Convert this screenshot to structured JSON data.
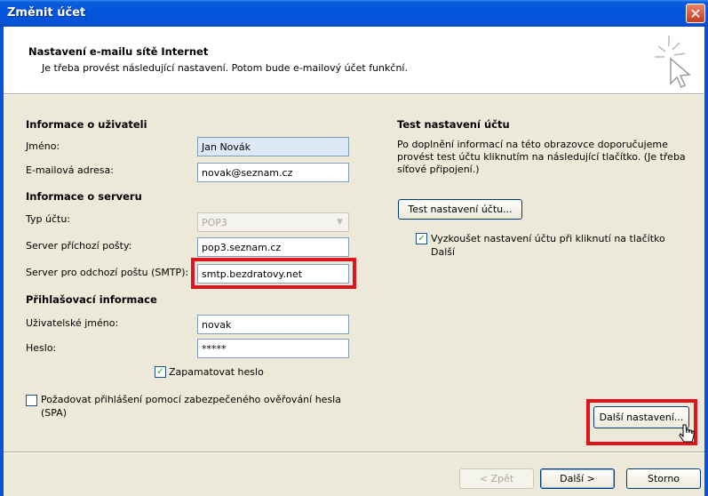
{
  "window": {
    "title": "Změnit účet"
  },
  "header": {
    "title": "Nastavení e-mailu sítě Internet",
    "subtitle": "Je třeba provést následující nastavení. Potom bude e-mailový účet funkční."
  },
  "user_info": {
    "section_title": "Informace o uživateli",
    "name_label": "Jméno:",
    "name_value": "Jan Novák",
    "email_label": "E-mailová adresa:",
    "email_value": "novak@seznam.cz"
  },
  "server_info": {
    "section_title": "Informace o serveru",
    "account_type_label": "Typ účtu:",
    "account_type_value": "POP3",
    "incoming_label": "Server příchozí pošty:",
    "incoming_value": "pop3.seznam.cz",
    "outgoing_label": "Server pro odchozí poštu (SMTP):",
    "outgoing_value": "smtp.bezdratovy.net"
  },
  "login_info": {
    "section_title": "Přihlašovací informace",
    "username_label": "Uživatelské jméno:",
    "username_value": "novak",
    "password_label": "Heslo:",
    "password_value": "*****",
    "remember_label": "Zapamatovat heslo",
    "remember_checked": true,
    "spa_label_line1": "Požadovat přihlášení pomocí zabezpečeného ověřování hesla",
    "spa_label_line2": "(SPA)",
    "spa_checked": false
  },
  "test": {
    "section_title": "Test nastavení účtu",
    "description_line1": "Po doplnění informací na této obrazovce doporučujeme",
    "description_line2": "provést test účtu kliknutím na následující tlačítko. (Je třeba",
    "description_line3": "síťové připojení.)",
    "test_button": "Test nastavení účtu...",
    "auto_test_label_line1": "Vyzkoušet nastavení účtu při kliknutí na tlačítko",
    "auto_test_label_line2": "Další",
    "auto_test_checked": true
  },
  "more_settings_button": "Další nastavení...",
  "footer": {
    "back_button": "< Zpět",
    "next_button": "Další >",
    "cancel_button": "Storno"
  },
  "icons": {
    "checkmark": "✓",
    "close": "✕",
    "dropdown": "▼"
  },
  "colors": {
    "titlebar": "#0553d6",
    "highlight": "#e0141e",
    "dialog_bg": "#ece9d8"
  }
}
